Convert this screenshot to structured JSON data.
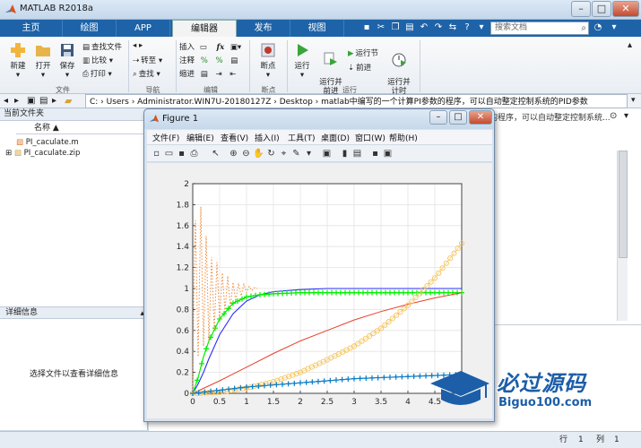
{
  "app": {
    "title": "MATLAB R2018a"
  },
  "tabs": [
    "主页",
    "绘图",
    "APP",
    "编辑器",
    "发布",
    "视图"
  ],
  "search_placeholder": "搜索文档",
  "ribbon": {
    "file": {
      "new": "新建",
      "open": "打开",
      "save": "保存",
      "find_files": "查找文件",
      "compare": "比较",
      "print": "打印",
      "group": "文件"
    },
    "nav": {
      "goto": "转至",
      "find": "查找",
      "group": "导航"
    },
    "edit": {
      "insert": "插入",
      "comment": "注释",
      "indent": "缩进",
      "group": "编辑"
    },
    "breakpoints": {
      "label": "断点",
      "group": "断点"
    },
    "run": {
      "run": "运行",
      "run_advance": "运行并\n前进",
      "run_section": "运行节",
      "advance": "前进",
      "run_time": "运行并\n计时",
      "group": "运行"
    }
  },
  "address": {
    "path": "C: › Users › Administrator.WIN7U-20180127Z › Desktop › matlab中编写的一个计算PI参数的程序，可以自动整定控制系统的PID参数"
  },
  "folder_panel": {
    "title": "当前文件夹",
    "name_col": "名称 ▲",
    "files": [
      "PI_caculate.m",
      "PI_caculate.zip"
    ]
  },
  "details": {
    "title": "详细信息",
    "message": "选择文件以查看详细信息"
  },
  "bg_tab_text": "的程序，可以自动整定控制系统...",
  "status": {
    "row_label": "行",
    "row": "1",
    "col_label": "列",
    "col": "1"
  },
  "figure": {
    "title": "Figure 1",
    "menu": [
      "文件(F)",
      "编辑(E)",
      "查看(V)",
      "插入(I)",
      "工具(T)",
      "桌面(D)",
      "窗口(W)",
      "帮助(H)"
    ]
  },
  "logo": {
    "text": "必过源码",
    "url": "Biguo100.com"
  },
  "colors": {
    "ribbon_tab_bar": "#1e63a8",
    "blue": "#2b2bff",
    "green": "#00ee00",
    "red": "#e8412a",
    "orange_o": "#f5c45a",
    "teal_plus": "#0a7bc4",
    "orange_dotted": "#f08a3a"
  },
  "chart_data": {
    "type": "line",
    "xlim": [
      0,
      5
    ],
    "ylim": [
      0,
      2
    ],
    "xticks": [
      "0",
      "0.5",
      "1",
      "1.5",
      "2",
      "2.5",
      "3",
      "3.5",
      "4",
      "4.5",
      "5"
    ],
    "yticks": [
      "0",
      "0.2",
      "0.4",
      "0.6",
      "0.8",
      "1",
      "1.2",
      "1.4",
      "1.6",
      "1.8",
      "2"
    ],
    "grid": true,
    "series": [
      {
        "style": "solid-blue",
        "x": [
          0,
          0.1,
          0.2,
          0.3,
          0.5,
          0.75,
          1.0,
          1.25,
          1.5,
          2.0,
          2.5,
          3.0,
          3.5,
          4.0,
          4.5,
          5.0
        ],
        "y": [
          0,
          0.09,
          0.2,
          0.33,
          0.56,
          0.76,
          0.88,
          0.94,
          0.97,
          0.99,
          1.0,
          1.0,
          1.0,
          1.0,
          1.0,
          1.0
        ]
      },
      {
        "style": "green-plus",
        "x": [
          0,
          0.1,
          0.2,
          0.3,
          0.5,
          0.75,
          1.0,
          1.25,
          1.5,
          2.0,
          2.5,
          3.0,
          3.5,
          4.0,
          4.5,
          5.0
        ],
        "y": [
          0,
          0.15,
          0.35,
          0.5,
          0.71,
          0.86,
          0.92,
          0.94,
          0.95,
          0.96,
          0.96,
          0.96,
          0.96,
          0.96,
          0.96,
          0.96
        ]
      },
      {
        "style": "solid-red",
        "x": [
          0,
          0.5,
          1.0,
          1.5,
          2.0,
          2.5,
          3.0,
          3.5,
          4.0,
          4.5,
          5.0
        ],
        "y": [
          0,
          0.12,
          0.25,
          0.38,
          0.5,
          0.6,
          0.7,
          0.78,
          0.85,
          0.91,
          0.96
        ]
      },
      {
        "style": "orange-o",
        "x": [
          0,
          0.5,
          1.0,
          1.5,
          2.0,
          2.5,
          3.0,
          3.5,
          4.0,
          4.5,
          5.0
        ],
        "y": [
          0,
          0.01,
          0.05,
          0.11,
          0.2,
          0.32,
          0.45,
          0.62,
          0.84,
          1.1,
          1.43
        ]
      },
      {
        "style": "teal-plus",
        "x": [
          0,
          0.5,
          1.0,
          1.5,
          2.0,
          2.5,
          3.0,
          3.5,
          4.0,
          4.5,
          5.0
        ],
        "y": [
          0,
          0.03,
          0.06,
          0.08,
          0.1,
          0.12,
          0.14,
          0.15,
          0.16,
          0.17,
          0.18
        ]
      },
      {
        "style": "orange-dotted",
        "x": [
          0,
          0.02,
          0.05,
          0.1,
          0.15,
          0.2,
          0.25,
          0.3,
          0.35,
          0.4,
          0.45,
          0.5,
          0.55,
          0.6,
          0.65,
          0.7,
          0.75,
          0.8,
          0.85,
          0.9,
          0.95,
          1.0,
          1.05,
          1.1,
          1.15,
          1.2
        ],
        "y": [
          0,
          1.0,
          1.65,
          0.35,
          1.78,
          0.45,
          1.5,
          0.5,
          1.3,
          0.6,
          1.25,
          0.7,
          1.15,
          0.78,
          1.12,
          0.82,
          1.06,
          0.88,
          1.05,
          0.93,
          1.04,
          0.96,
          1.02,
          0.98,
          1.01,
          1.0
        ]
      }
    ]
  }
}
